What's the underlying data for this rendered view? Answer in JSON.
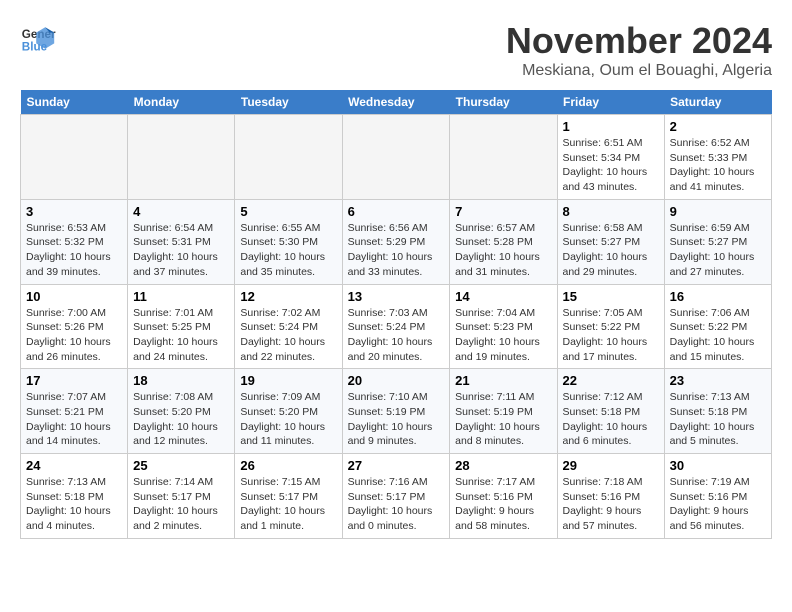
{
  "logo": {
    "line1": "General",
    "line2": "Blue"
  },
  "title": "November 2024",
  "subtitle": "Meskiana, Oum el Bouaghi, Algeria",
  "weekdays": [
    "Sunday",
    "Monday",
    "Tuesday",
    "Wednesday",
    "Thursday",
    "Friday",
    "Saturday"
  ],
  "weeks": [
    [
      {
        "day": "",
        "empty": true
      },
      {
        "day": "",
        "empty": true
      },
      {
        "day": "",
        "empty": true
      },
      {
        "day": "",
        "empty": true
      },
      {
        "day": "",
        "empty": true
      },
      {
        "day": "1",
        "sunrise": "6:51 AM",
        "sunset": "5:34 PM",
        "daylight": "10 hours and 43 minutes."
      },
      {
        "day": "2",
        "sunrise": "6:52 AM",
        "sunset": "5:33 PM",
        "daylight": "10 hours and 41 minutes."
      }
    ],
    [
      {
        "day": "3",
        "sunrise": "6:53 AM",
        "sunset": "5:32 PM",
        "daylight": "10 hours and 39 minutes."
      },
      {
        "day": "4",
        "sunrise": "6:54 AM",
        "sunset": "5:31 PM",
        "daylight": "10 hours and 37 minutes."
      },
      {
        "day": "5",
        "sunrise": "6:55 AM",
        "sunset": "5:30 PM",
        "daylight": "10 hours and 35 minutes."
      },
      {
        "day": "6",
        "sunrise": "6:56 AM",
        "sunset": "5:29 PM",
        "daylight": "10 hours and 33 minutes."
      },
      {
        "day": "7",
        "sunrise": "6:57 AM",
        "sunset": "5:28 PM",
        "daylight": "10 hours and 31 minutes."
      },
      {
        "day": "8",
        "sunrise": "6:58 AM",
        "sunset": "5:27 PM",
        "daylight": "10 hours and 29 minutes."
      },
      {
        "day": "9",
        "sunrise": "6:59 AM",
        "sunset": "5:27 PM",
        "daylight": "10 hours and 27 minutes."
      }
    ],
    [
      {
        "day": "10",
        "sunrise": "7:00 AM",
        "sunset": "5:26 PM",
        "daylight": "10 hours and 26 minutes."
      },
      {
        "day": "11",
        "sunrise": "7:01 AM",
        "sunset": "5:25 PM",
        "daylight": "10 hours and 24 minutes."
      },
      {
        "day": "12",
        "sunrise": "7:02 AM",
        "sunset": "5:24 PM",
        "daylight": "10 hours and 22 minutes."
      },
      {
        "day": "13",
        "sunrise": "7:03 AM",
        "sunset": "5:24 PM",
        "daylight": "10 hours and 20 minutes."
      },
      {
        "day": "14",
        "sunrise": "7:04 AM",
        "sunset": "5:23 PM",
        "daylight": "10 hours and 19 minutes."
      },
      {
        "day": "15",
        "sunrise": "7:05 AM",
        "sunset": "5:22 PM",
        "daylight": "10 hours and 17 minutes."
      },
      {
        "day": "16",
        "sunrise": "7:06 AM",
        "sunset": "5:22 PM",
        "daylight": "10 hours and 15 minutes."
      }
    ],
    [
      {
        "day": "17",
        "sunrise": "7:07 AM",
        "sunset": "5:21 PM",
        "daylight": "10 hours and 14 minutes."
      },
      {
        "day": "18",
        "sunrise": "7:08 AM",
        "sunset": "5:20 PM",
        "daylight": "10 hours and 12 minutes."
      },
      {
        "day": "19",
        "sunrise": "7:09 AM",
        "sunset": "5:20 PM",
        "daylight": "10 hours and 11 minutes."
      },
      {
        "day": "20",
        "sunrise": "7:10 AM",
        "sunset": "5:19 PM",
        "daylight": "10 hours and 9 minutes."
      },
      {
        "day": "21",
        "sunrise": "7:11 AM",
        "sunset": "5:19 PM",
        "daylight": "10 hours and 8 minutes."
      },
      {
        "day": "22",
        "sunrise": "7:12 AM",
        "sunset": "5:18 PM",
        "daylight": "10 hours and 6 minutes."
      },
      {
        "day": "23",
        "sunrise": "7:13 AM",
        "sunset": "5:18 PM",
        "daylight": "10 hours and 5 minutes."
      }
    ],
    [
      {
        "day": "24",
        "sunrise": "7:13 AM",
        "sunset": "5:18 PM",
        "daylight": "10 hours and 4 minutes."
      },
      {
        "day": "25",
        "sunrise": "7:14 AM",
        "sunset": "5:17 PM",
        "daylight": "10 hours and 2 minutes."
      },
      {
        "day": "26",
        "sunrise": "7:15 AM",
        "sunset": "5:17 PM",
        "daylight": "10 hours and 1 minute."
      },
      {
        "day": "27",
        "sunrise": "7:16 AM",
        "sunset": "5:17 PM",
        "daylight": "10 hours and 0 minutes."
      },
      {
        "day": "28",
        "sunrise": "7:17 AM",
        "sunset": "5:16 PM",
        "daylight": "9 hours and 58 minutes."
      },
      {
        "day": "29",
        "sunrise": "7:18 AM",
        "sunset": "5:16 PM",
        "daylight": "9 hours and 57 minutes."
      },
      {
        "day": "30",
        "sunrise": "7:19 AM",
        "sunset": "5:16 PM",
        "daylight": "9 hours and 56 minutes."
      }
    ]
  ]
}
